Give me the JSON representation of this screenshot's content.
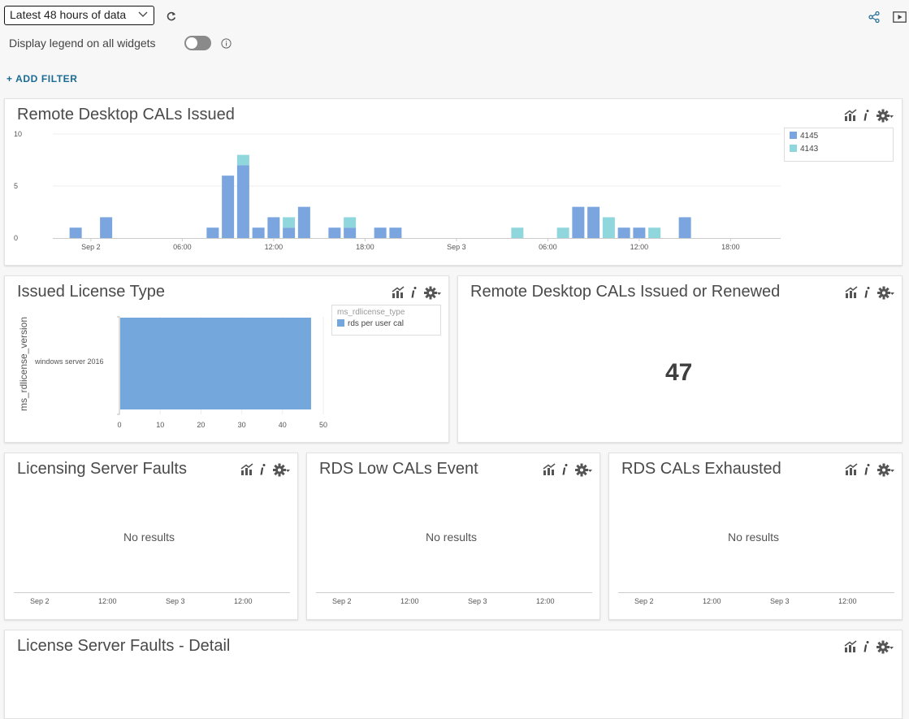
{
  "toolbar": {
    "time_range": "Latest 48 hours of data",
    "legend_toggle_label": "Display legend on all widgets",
    "legend_toggle_on": false,
    "add_filter_label": "+ ADD FILTER"
  },
  "colors": {
    "series_4145": "#7aa5de",
    "series_4143": "#8fd7dc",
    "bar_license": "#74a7dc",
    "toolbar_link": "#1a6b94"
  },
  "widgets": {
    "cals_issued": {
      "title": "Remote Desktop CALs Issued",
      "chart_data": {
        "type": "bar",
        "stacked": true,
        "y_ticks": [
          "10",
          "5",
          "0"
        ],
        "ylim": [
          0,
          10
        ],
        "x_ticks": [
          "Sep 2",
          "06:00",
          "12:00",
          "18:00",
          "Sep 3",
          "06:00",
          "12:00",
          "18:00"
        ],
        "legend": [
          "4145",
          "4143"
        ],
        "legend_placement": "right",
        "bins_per_day": 24,
        "x_start_hour": 22,
        "series": [
          {
            "name": "4145",
            "points": [
              [
                1,
                1
              ],
              [
                3,
                2
              ],
              [
                10,
                1
              ],
              [
                11,
                6
              ],
              [
                12,
                7
              ],
              [
                13,
                1
              ],
              [
                14,
                2
              ],
              [
                15,
                1
              ],
              [
                16,
                3
              ],
              [
                18,
                1
              ],
              [
                19,
                1
              ],
              [
                21,
                1
              ],
              [
                22,
                1
              ],
              [
                34,
                3
              ],
              [
                35,
                3
              ],
              [
                36,
                0
              ],
              [
                37,
                1
              ],
              [
                38,
                1
              ],
              [
                39,
                0
              ],
              [
                41,
                2
              ]
            ]
          },
          {
            "name": "4143",
            "points": [
              [
                12,
                1
              ],
              [
                15,
                1
              ],
              [
                19,
                1
              ],
              [
                30,
                1
              ],
              [
                33,
                1
              ],
              [
                36,
                2
              ],
              [
                39,
                1
              ]
            ]
          }
        ]
      }
    },
    "license_type": {
      "title": "Issued License Type",
      "chart_data": {
        "type": "bar",
        "orientation": "horizontal",
        "categories": [
          "windows server 2016"
        ],
        "series": [
          {
            "name": "rds per user cal",
            "values": [
              47
            ]
          }
        ],
        "ylabel": "ms_rdlicense_version",
        "legend_title": "ms_rdlicense_type",
        "x_ticks": [
          "0",
          "10",
          "20",
          "30",
          "40",
          "50"
        ],
        "xlim": [
          0,
          50
        ]
      }
    },
    "cals_renewed": {
      "title": "Remote Desktop CALs Issued or Renewed",
      "value": "47"
    },
    "server_faults": {
      "title": "Licensing Server Faults",
      "empty_text": "No results",
      "x_ticks": [
        "Sep 2",
        "12:00",
        "Sep 3",
        "12:00"
      ]
    },
    "low_cals": {
      "title": "RDS Low CALs Event",
      "empty_text": "No results",
      "x_ticks": [
        "Sep 2",
        "12:00",
        "Sep 3",
        "12:00"
      ]
    },
    "cals_exhausted": {
      "title": "RDS CALs Exhausted",
      "empty_text": "No results",
      "x_ticks": [
        "Sep 2",
        "12:00",
        "Sep 3",
        "12:00"
      ]
    },
    "faults_detail": {
      "title": "License Server Faults - Detail"
    }
  },
  "icons": [
    "chevron-down-icon",
    "refresh-icon",
    "share-icon",
    "presentation-icon",
    "info-circle-icon",
    "analytics-icon",
    "info-icon",
    "gear-icon"
  ]
}
